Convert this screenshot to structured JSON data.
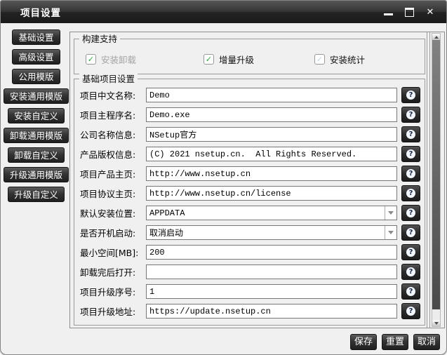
{
  "window": {
    "title": "项目设置"
  },
  "icons": {
    "help": "?",
    "check": "✓",
    "close": "✕"
  },
  "sidebar": {
    "items": [
      "基础设置",
      "高级设置",
      "公用模版",
      "安装通用模版",
      "安装自定义",
      "卸载通用模版",
      "卸载自定义",
      "升级通用模版",
      "升级自定义"
    ]
  },
  "build_support": {
    "legend": "构建支持",
    "checkboxes": [
      {
        "label": "安装卸载",
        "checked": true,
        "disabled": true
      },
      {
        "label": "增量升级",
        "checked": true,
        "disabled": false
      },
      {
        "label": "安装统计",
        "checked": true,
        "disabled": true
      }
    ]
  },
  "basic_settings": {
    "legend": "基础项目设置",
    "fields": [
      {
        "label": "项目中文名称:",
        "value": "Demo",
        "type": "text"
      },
      {
        "label": "项目主程序名:",
        "value": "Demo.exe",
        "type": "text"
      },
      {
        "label": "公司名称信息:",
        "value": "NSetup官方",
        "type": "text"
      },
      {
        "label": "产品版权信息:",
        "value": "(C) 2021 nsetup.cn.  All Rights Reserved.",
        "type": "text"
      },
      {
        "label": "项目产品主页:",
        "value": "http://www.nsetup.cn",
        "type": "text"
      },
      {
        "label": "项目协议主页:",
        "value": "http://www.nsetup.cn/license",
        "type": "text"
      },
      {
        "label": "默认安装位置:",
        "value": "APPDATA",
        "type": "select"
      },
      {
        "label": "是否开机启动:",
        "value": "取消启动",
        "type": "select"
      },
      {
        "label": "最小空间[MB]:",
        "value": "200",
        "type": "text"
      },
      {
        "label": "卸载完后打开:",
        "value": "",
        "type": "text"
      },
      {
        "label": "项目升级序号:",
        "value": "1",
        "type": "text"
      },
      {
        "label": "项目升级地址:",
        "value": "https://update.nsetup.cn",
        "type": "text"
      }
    ]
  },
  "footer": {
    "save_label": "保存",
    "reset_label": "重置",
    "cancel_label": "取消"
  },
  "colors": {
    "background": "#f0f0f0",
    "titlebar_dark": "#2c2c2c",
    "button_dark": "#303030",
    "check_green": "#2fa832",
    "check_disabled": "#c3d5e6",
    "panel_border": "#8f8f8f"
  }
}
